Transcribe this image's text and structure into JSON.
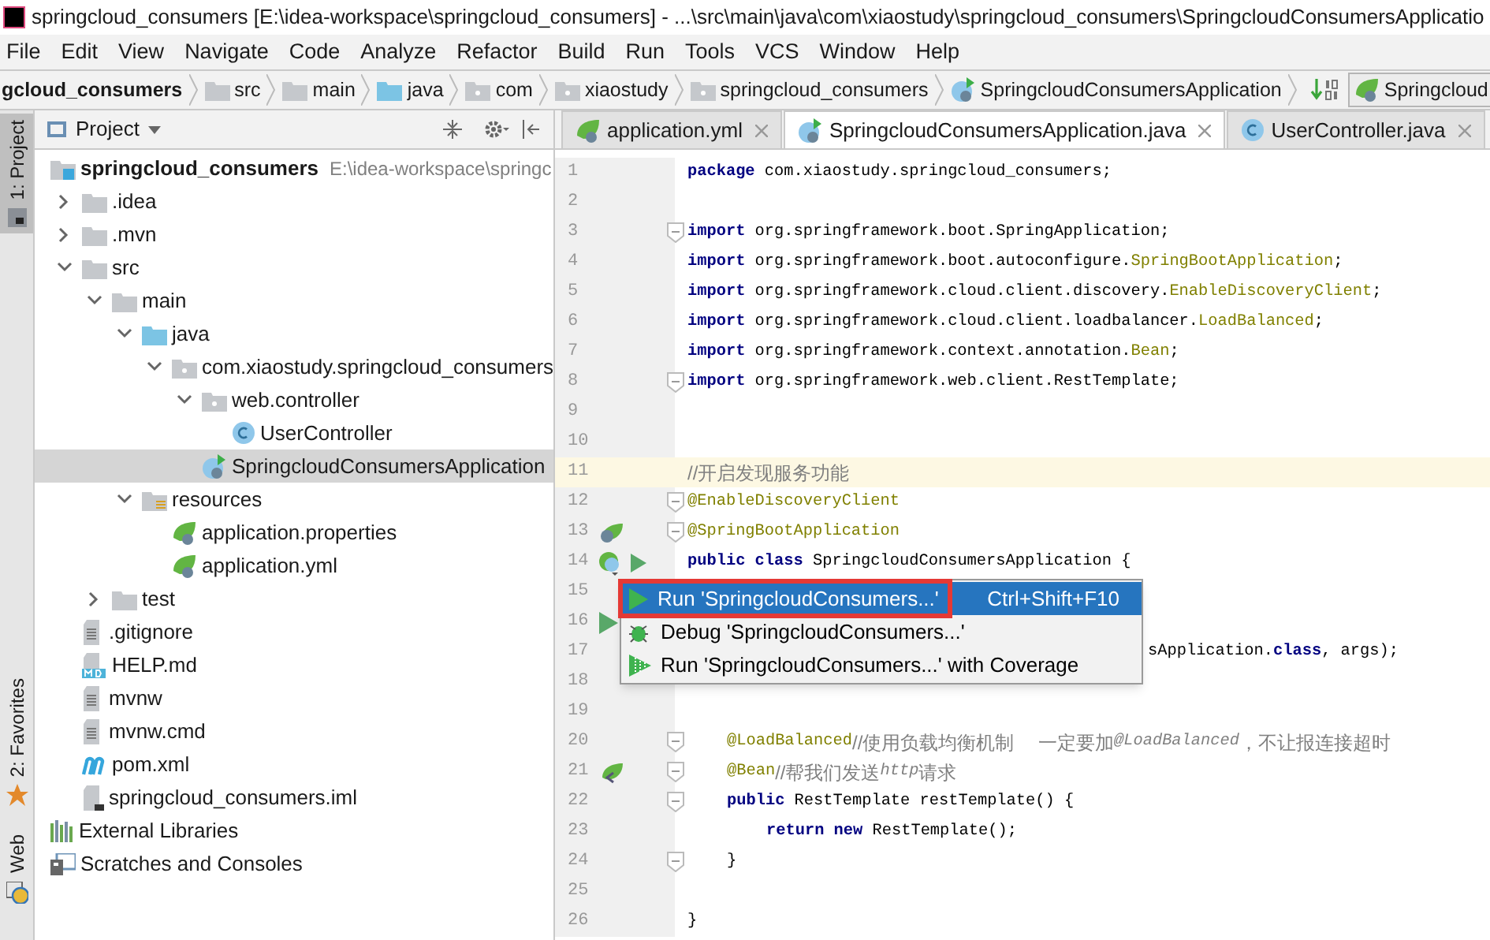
{
  "window": {
    "title": "springcloud_consumers [E:\\idea-workspace\\springcloud_consumers] - ...\\src\\main\\java\\com\\xiaostudy\\springcloud_consumers\\SpringcloudConsumersApplicatio"
  },
  "menu": [
    "File",
    "Edit",
    "View",
    "Navigate",
    "Code",
    "Analyze",
    "Refactor",
    "Build",
    "Run",
    "Tools",
    "VCS",
    "Window",
    "Help"
  ],
  "breadcrumbs": [
    {
      "label": "gcloud_consumers"
    },
    {
      "label": "src",
      "kind": "folder"
    },
    {
      "label": "main",
      "kind": "folder"
    },
    {
      "label": "java",
      "kind": "source-folder"
    },
    {
      "label": "com",
      "kind": "package"
    },
    {
      "label": "xiaostudy",
      "kind": "package"
    },
    {
      "label": "springcloud_consumers",
      "kind": "package"
    },
    {
      "label": "SpringcloudConsumersApplication",
      "kind": "spring-class"
    }
  ],
  "run_config": {
    "label": "Springcloud"
  },
  "side_tabs": [
    {
      "label": "1: Project",
      "selected": true,
      "kind": "project"
    },
    {
      "label": "2: Favorites",
      "selected": false,
      "kind": "favorites"
    },
    {
      "label": "Web",
      "selected": false,
      "kind": "web"
    }
  ],
  "project_panel": {
    "title": "Project",
    "tree": [
      {
        "label": "springcloud_consumers",
        "path": "E:\\idea-workspace\\springc",
        "kind": "module",
        "selected": false,
        "children": [
          {
            "label": ".idea",
            "kind": "folder",
            "expanded": false,
            "selected": false
          },
          {
            "label": ".mvn",
            "kind": "folder",
            "expanded": false,
            "selected": false
          },
          {
            "label": "src",
            "kind": "folder",
            "expanded": true,
            "selected": false,
            "children": [
              {
                "label": "main",
                "kind": "folder",
                "expanded": true,
                "selected": false,
                "children": [
                  {
                    "label": "java",
                    "kind": "source-folder",
                    "expanded": true,
                    "selected": false,
                    "children": [
                      {
                        "label": "com.xiaostudy.springcloud_consumers",
                        "kind": "package",
                        "expanded": true,
                        "selected": false,
                        "children": [
                          {
                            "label": "web.controller",
                            "kind": "package",
                            "expanded": true,
                            "selected": false,
                            "children": [
                              {
                                "label": "UserController",
                                "kind": "class",
                                "selected": false
                              }
                            ]
                          },
                          {
                            "label": "SpringcloudConsumersApplication",
                            "kind": "spring-class",
                            "selected": true
                          }
                        ]
                      }
                    ]
                  },
                  {
                    "label": "resources",
                    "kind": "resources-folder",
                    "expanded": true,
                    "selected": false,
                    "children": [
                      {
                        "label": "application.properties",
                        "kind": "spring-file",
                        "selected": false
                      },
                      {
                        "label": "application.yml",
                        "kind": "spring-file",
                        "selected": false
                      }
                    ]
                  }
                ]
              },
              {
                "label": "test",
                "kind": "folder",
                "expanded": false,
                "selected": false
              }
            ]
          },
          {
            "label": ".gitignore",
            "kind": "text-file",
            "selected": false
          },
          {
            "label": "HELP.md",
            "kind": "md-file",
            "selected": false
          },
          {
            "label": "mvnw",
            "kind": "text-file",
            "selected": false
          },
          {
            "label": "mvnw.cmd",
            "kind": "text-file",
            "selected": false
          },
          {
            "label": "pom.xml",
            "kind": "maven-file",
            "selected": false
          },
          {
            "label": "springcloud_consumers.iml",
            "kind": "iml-file",
            "selected": false
          }
        ]
      },
      {
        "label": "External Libraries",
        "kind": "libraries",
        "selected": false
      },
      {
        "label": "Scratches and Consoles",
        "kind": "scratches",
        "selected": false
      }
    ]
  },
  "editor_tabs": [
    {
      "label": "application.yml",
      "kind": "spring-file",
      "selected": false
    },
    {
      "label": "SpringcloudConsumersApplication.java",
      "kind": "spring-class",
      "selected": true
    },
    {
      "label": "UserController.java",
      "kind": "class",
      "selected": false
    }
  ],
  "code_lines": [
    {
      "number": "1",
      "current": false,
      "fold": false,
      "segments": [
        {
          "kind": "keyword",
          "text": "package"
        },
        {
          "kind": "plain",
          "text": " com.xiaostudy.springcloud_consumers;"
        }
      ]
    },
    {
      "number": "2",
      "current": false,
      "fold": false
    },
    {
      "number": "3",
      "current": false,
      "fold": true,
      "segments": [
        {
          "kind": "keyword",
          "text": "import"
        },
        {
          "kind": "plain",
          "text": " org.springframework.boot.SpringApplication;"
        }
      ]
    },
    {
      "number": "4",
      "current": false,
      "fold": false,
      "segments": [
        {
          "kind": "keyword",
          "text": "import"
        },
        {
          "kind": "plain",
          "text": " org.springframework.boot.autoconfigure."
        },
        {
          "kind": "annotation",
          "text": "SpringBootApplication"
        },
        {
          "kind": "plain",
          "text": ";"
        }
      ]
    },
    {
      "number": "5",
      "current": false,
      "fold": false,
      "segments": [
        {
          "kind": "keyword",
          "text": "import"
        },
        {
          "kind": "plain",
          "text": " org.springframework.cloud.client.discovery."
        },
        {
          "kind": "annotation",
          "text": "EnableDiscoveryClient"
        },
        {
          "kind": "plain",
          "text": ";"
        }
      ]
    },
    {
      "number": "6",
      "current": false,
      "fold": false,
      "segments": [
        {
          "kind": "keyword",
          "text": "import"
        },
        {
          "kind": "plain",
          "text": " org.springframework.cloud.client.loadbalancer."
        },
        {
          "kind": "annotation",
          "text": "LoadBalanced"
        },
        {
          "kind": "plain",
          "text": ";"
        }
      ]
    },
    {
      "number": "7",
      "current": false,
      "fold": false,
      "segments": [
        {
          "kind": "keyword",
          "text": "import"
        },
        {
          "kind": "plain",
          "text": " org.springframework.context.annotation."
        },
        {
          "kind": "annotation",
          "text": "Bean"
        },
        {
          "kind": "plain",
          "text": ";"
        }
      ]
    },
    {
      "number": "8",
      "current": false,
      "fold": true,
      "segments": [
        {
          "kind": "keyword",
          "text": "import"
        },
        {
          "kind": "plain",
          "text": " org.springframework.web.client.RestTemplate;"
        }
      ]
    },
    {
      "number": "9",
      "current": false,
      "fold": false
    },
    {
      "number": "10",
      "current": false,
      "fold": false
    },
    {
      "number": "11",
      "current": true,
      "fold": false,
      "segments": [
        {
          "kind": "comment",
          "text": "//开启发现服务功能"
        }
      ]
    },
    {
      "number": "12",
      "current": false,
      "fold": true,
      "segments": [
        {
          "kind": "annotation",
          "text": "@EnableDiscoveryClient"
        }
      ]
    },
    {
      "number": "13",
      "current": false,
      "fold": true,
      "gutter_icon": {
        "kind": "bean"
      },
      "segments": [
        {
          "kind": "annotation",
          "text": "@SpringBootApplication"
        }
      ]
    },
    {
      "number": "14",
      "current": false,
      "fold": false,
      "gutter_icon": {
        "kind": "class-run"
      },
      "segments": [
        {
          "kind": "keyword",
          "text": "public class"
        },
        {
          "kind": "plain",
          "text": " SpringcloudConsumersApplication {"
        }
      ],
      "children": [
        {
          "number": "15",
          "current": false,
          "fold": false
        },
        {
          "number": "16",
          "current": false,
          "fold": false,
          "gutter_icon": {
            "kind": "run"
          }
        },
        {
          "number": "17",
          "current": false,
          "fold": false,
          "kind": "overlapped",
          "segments": [
            {
              "kind": "plain",
              "text": "sApplication."
            },
            {
              "kind": "keyword",
              "text": "class"
            },
            {
              "kind": "plain",
              "text": ", args);"
            }
          ]
        },
        {
          "number": "18",
          "current": false,
          "fold": false
        },
        {
          "number": "19",
          "current": false,
          "fold": false
        },
        {
          "number": "20",
          "current": false,
          "fold": true,
          "segments": [
            {
              "kind": "annotation",
              "text": "@LoadBalanced"
            },
            {
              "kind": "comment",
              "text": "//使用负载均衡机制　 一定要加"
            },
            {
              "kind": "comment-italic",
              "text": "@LoadBalanced"
            },
            {
              "kind": "comment",
              "text": "，不让报连接超时"
            }
          ]
        },
        {
          "number": "21",
          "current": false,
          "fold": true,
          "gutter_icon": {
            "kind": "bean-link"
          },
          "segments": [
            {
              "kind": "annotation",
              "text": "@Bean"
            },
            {
              "kind": "comment",
              "text": "//帮我们发送"
            },
            {
              "kind": "comment-italic",
              "text": "http"
            },
            {
              "kind": "comment",
              "text": "请求"
            }
          ]
        },
        {
          "number": "22",
          "current": false,
          "fold": true,
          "segments": [
            {
              "kind": "keyword",
              "text": "public"
            },
            {
              "kind": "plain",
              "text": " RestTemplate restTemplate() {"
            }
          ],
          "children": [
            {
              "number": "23",
              "current": false,
              "fold": false,
              "segments": [
                {
                  "kind": "keyword",
                  "text": "return new"
                },
                {
                  "kind": "plain",
                  "text": " RestTemplate();"
                }
              ]
            }
          ]
        },
        {
          "number": "24",
          "current": false,
          "fold": true,
          "segments": [
            {
              "kind": "plain",
              "text": "}"
            }
          ]
        },
        {
          "number": "25",
          "current": false,
          "fold": false
        }
      ]
    },
    {
      "number": "26",
      "current": false,
      "fold": false,
      "segments": [
        {
          "kind": "plain",
          "text": "}"
        }
      ]
    }
  ],
  "context_menu": [
    {
      "label": "Run 'SpringcloudConsumers...'",
      "shortcut": "Ctrl+Shift+F10",
      "kind": "run",
      "selected": true,
      "outlined": true
    },
    {
      "label": "Debug 'SpringcloudConsumers...'",
      "kind": "debug",
      "selected": false,
      "outlined": false
    },
    {
      "label": "Run 'SpringcloudConsumers...' with Coverage",
      "kind": "coverage",
      "selected": false,
      "outlined": false
    }
  ]
}
